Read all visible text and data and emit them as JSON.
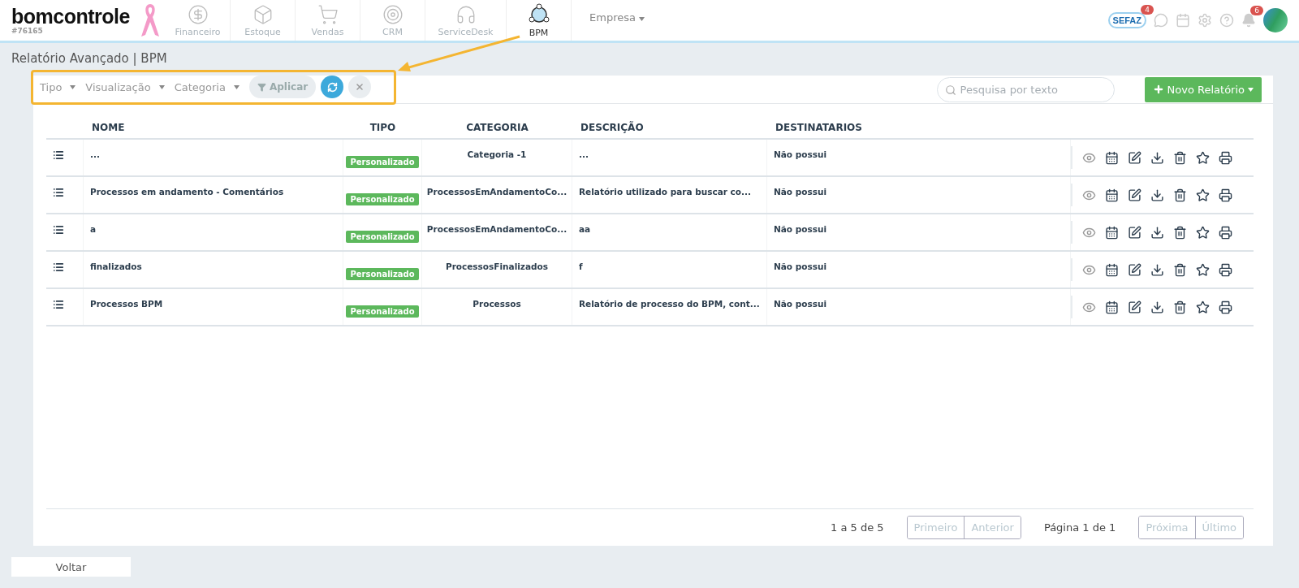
{
  "header": {
    "logo": "bomcontrole",
    "account": "#76165",
    "modules": [
      {
        "label": "Financeiro",
        "kind": "money",
        "selected": false
      },
      {
        "label": "Estoque",
        "kind": "box",
        "selected": false
      },
      {
        "label": "Vendas",
        "kind": "cart",
        "selected": false
      },
      {
        "label": "CRM",
        "kind": "target",
        "selected": false
      },
      {
        "label": "ServiceDesk",
        "kind": "headset",
        "selected": false
      },
      {
        "label": "BPM",
        "kind": "network",
        "selected": true
      }
    ],
    "company_menu": "Empresa",
    "sefaz": {
      "label": "SEFAZ",
      "badge": "4"
    },
    "notifications_badge": "6"
  },
  "page_title": "Relatório Avançado | BPM",
  "filters": [
    "Tipo",
    "Visualização",
    "Categoria"
  ],
  "apply_button": "Aplicar",
  "search": {
    "placeholder": "Pesquisa por texto"
  },
  "new_button": "Novo Relatório",
  "table": {
    "columns": [
      "NOME",
      "TIPO",
      "CATEGORIA",
      "DESCRIÇÃO",
      "DESTINATARIOS"
    ],
    "rows": [
      {
        "name": "...",
        "type": "Personalizado",
        "category": "Categoria -1",
        "description": "...",
        "recipients": "Não possui"
      },
      {
        "name": "Processos em andamento - Comentários",
        "type": "Personalizado",
        "category": "ProcessosEmAndamentoCo...",
        "description": "Relatório utilizado para buscar co...",
        "recipients": "Não possui"
      },
      {
        "name": "a",
        "type": "Personalizado",
        "category": "ProcessosEmAndamentoCo...",
        "description": "aa",
        "recipients": "Não possui"
      },
      {
        "name": "finalizados",
        "type": "Personalizado",
        "category": "ProcessosFinalizados",
        "description": "f",
        "recipients": "Não possui"
      },
      {
        "name": "Processos BPM",
        "type": "Personalizado",
        "category": "Processos",
        "description": "Relatório de processo do BPM, cont...",
        "recipients": "Não possui"
      }
    ]
  },
  "pagination": {
    "range": "1 a 5 de 5",
    "page": "Página 1 de 1",
    "prev_buttons": [
      {
        "label": "Primeiro",
        "disabled": true
      },
      {
        "label": "Anterior",
        "disabled": true
      }
    ],
    "next_buttons": [
      {
        "label": "Próxima",
        "disabled": true
      },
      {
        "label": "Último",
        "disabled": true
      }
    ]
  },
  "back_button": "Voltar"
}
